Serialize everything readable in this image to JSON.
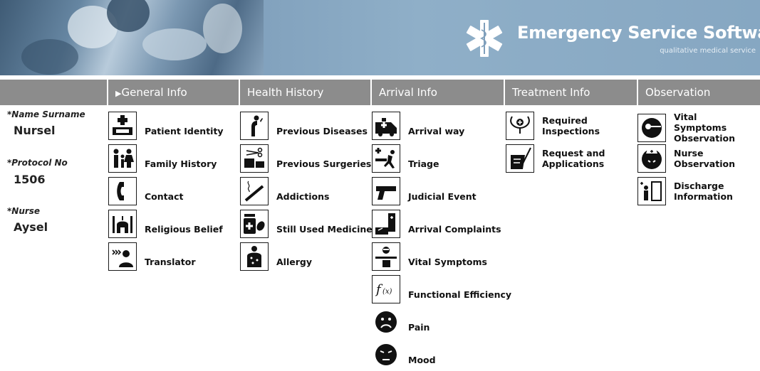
{
  "header": {
    "title": "Emergency Service Software",
    "subtitle": "qualitative medical service",
    "logo_icon": "star-of-life-icon"
  },
  "nav": {
    "tabs": [
      {
        "label": "General Info",
        "marker": "▶"
      },
      {
        "label": "Health History"
      },
      {
        "label": "Arrival Info"
      },
      {
        "label": "Treatment Info"
      },
      {
        "label": "Observation"
      }
    ]
  },
  "patient": {
    "name_label": "*Name Surname",
    "name_value": "Nursel",
    "protocol_label": "*Protocol No",
    "protocol_value": "1506",
    "nurse_label": "*Nurse",
    "nurse_value": "Aysel"
  },
  "general_info": [
    {
      "label": "Patient Identity",
      "icon": "id-card-icon"
    },
    {
      "label": "Family History",
      "icon": "family-icon"
    },
    {
      "label": "Contact",
      "icon": "phone-icon"
    },
    {
      "label": "Religious Belief",
      "icon": "mosque-icon"
    },
    {
      "label": "Translator",
      "icon": "translator-icon"
    }
  ],
  "health_history": [
    {
      "label": "Previous Diseases",
      "icon": "sick-person-icon"
    },
    {
      "label": "Previous Surgeries",
      "icon": "scissors-icon"
    },
    {
      "label": "Addictions",
      "icon": "cigarette-icon"
    },
    {
      "label": "Still Used Medicine",
      "icon": "medicine-icon"
    },
    {
      "label": "Allergy",
      "icon": "allergy-icon"
    }
  ],
  "arrival_info": [
    {
      "label": "Arrival way",
      "icon": "ambulance-icon"
    },
    {
      "label": "Triage",
      "icon": "triage-icon"
    },
    {
      "label": "Judicial Event",
      "icon": "gun-icon"
    },
    {
      "label": "Arrival Complaints",
      "icon": "complaint-icon"
    },
    {
      "label": "Vital Symptoms",
      "icon": "doctor-icon"
    },
    {
      "label": "Functional Efficiency",
      "icon": "function-icon"
    },
    {
      "label": "Pain",
      "icon": "pain-face-icon"
    },
    {
      "label": "Mood",
      "icon": "mood-face-icon"
    }
  ],
  "treatment_info": [
    {
      "label": "Required Inspections",
      "icon": "stethoscope-icon"
    },
    {
      "label": "Request and Applications",
      "icon": "request-form-icon"
    }
  ],
  "observation": [
    {
      "label": "Vital Symptoms Observation",
      "icon": "vital-observation-icon"
    },
    {
      "label": "Nurse Observation",
      "icon": "nurse-icon"
    },
    {
      "label": "Discharge Information",
      "icon": "discharge-door-icon"
    }
  ]
}
